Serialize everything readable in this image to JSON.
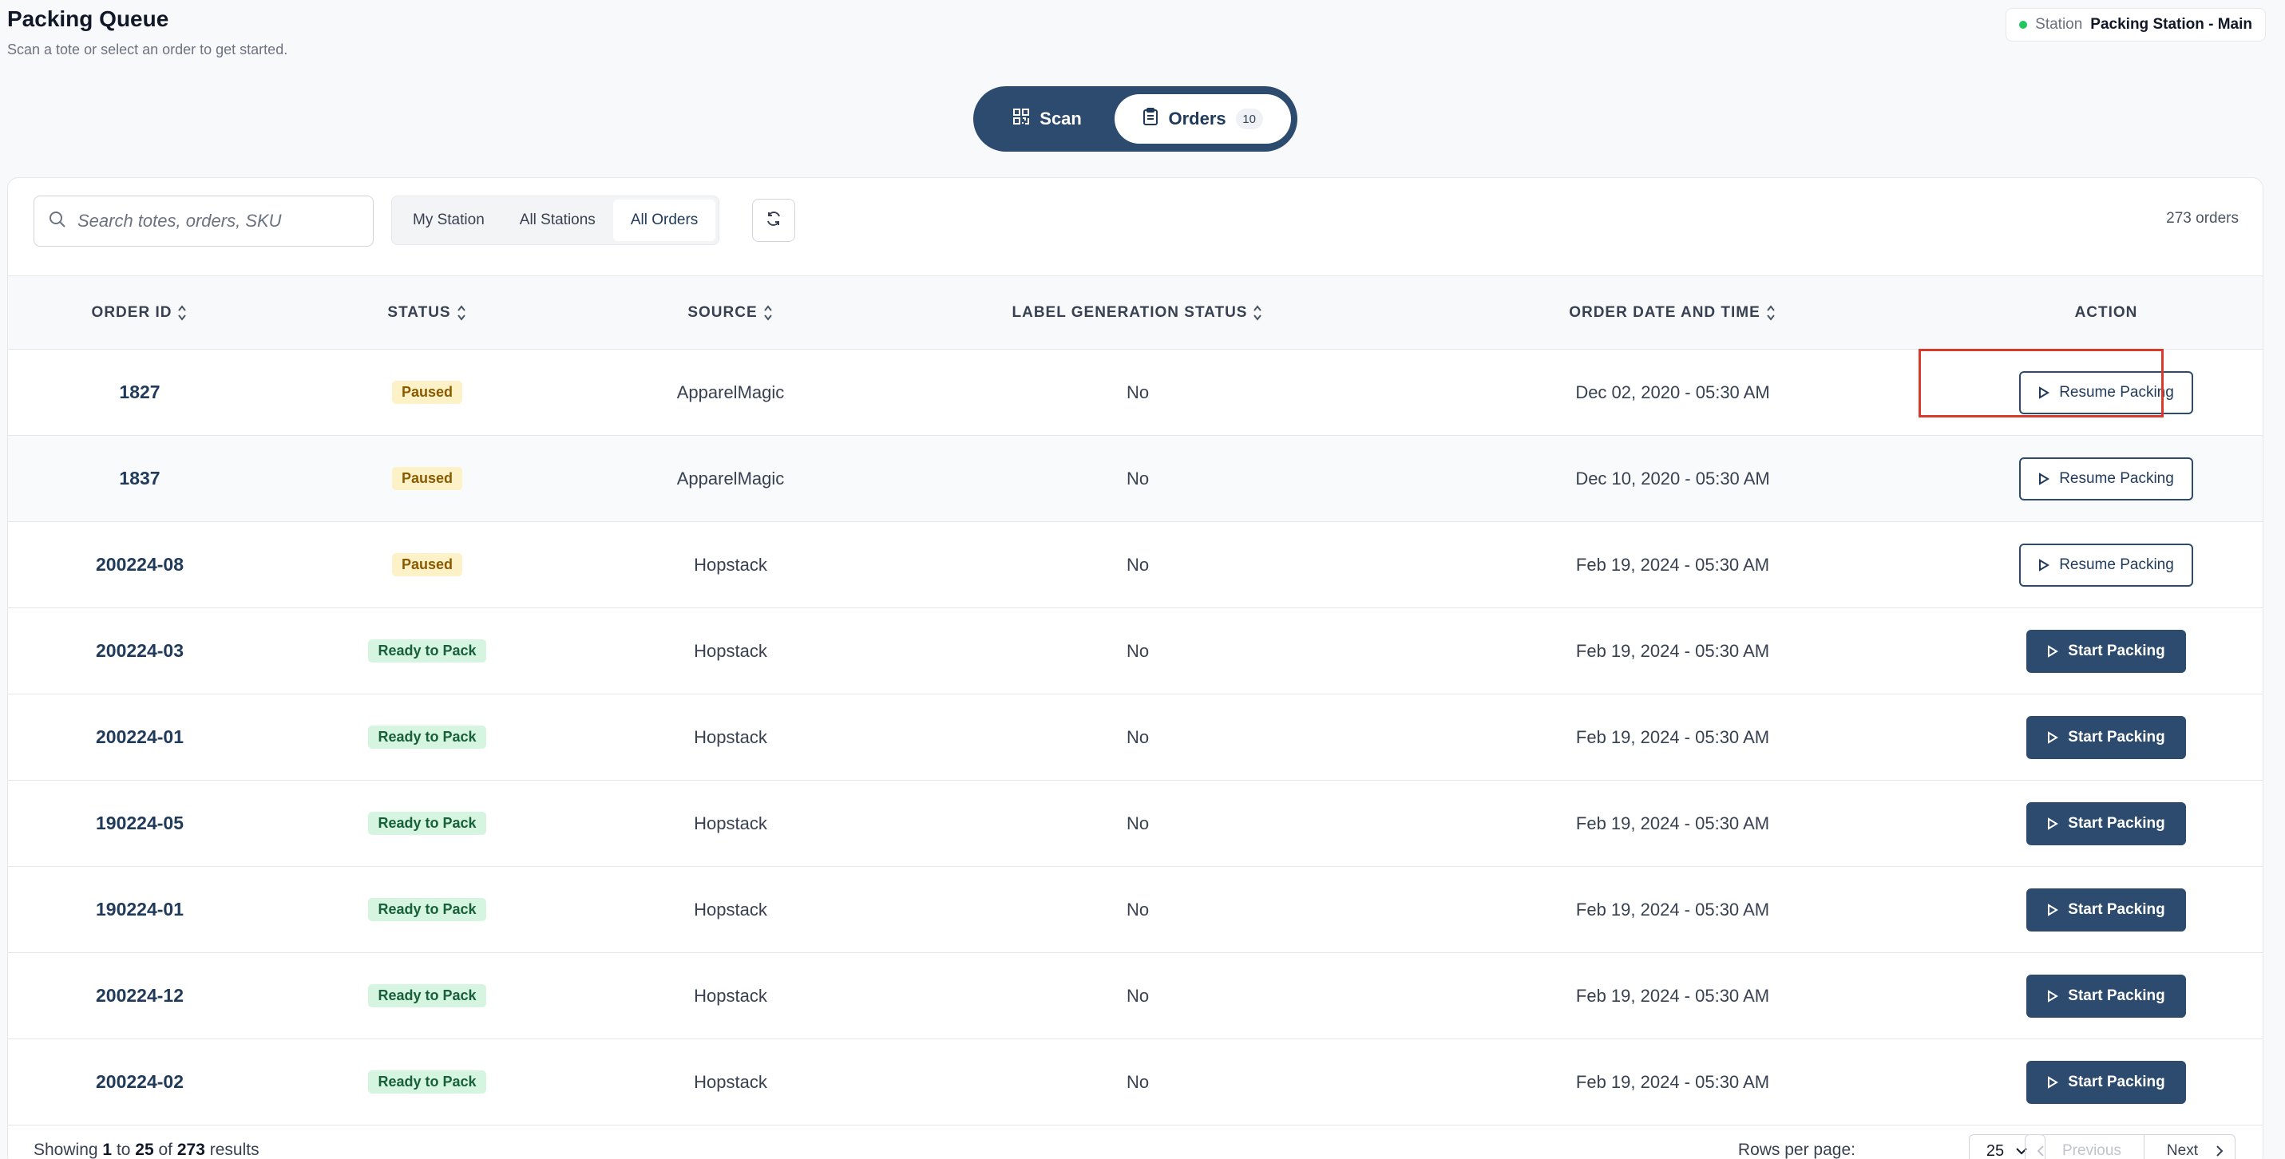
{
  "header": {
    "title": "Packing Queue",
    "subtitle": "Scan a tote or select an order to get started.",
    "station_label": "Station",
    "station_name": "Packing Station - Main"
  },
  "toggle": {
    "scan_label": "Scan",
    "orders_label": "Orders",
    "orders_count": "10"
  },
  "toolbar": {
    "search_placeholder": "Search totes, orders, SKU",
    "filters": [
      "My Station",
      "All Stations",
      "All Orders"
    ],
    "active_filter": "All Orders",
    "order_count": "273 orders"
  },
  "table": {
    "columns": [
      "ORDER ID",
      "STATUS",
      "SOURCE",
      "LABEL GENERATION STATUS",
      "ORDER DATE AND TIME",
      "ACTION"
    ],
    "rows": [
      {
        "order_id": "1827",
        "status": "Paused",
        "source": "ApparelMagic",
        "label": "No",
        "date": "Dec 02, 2020 - 05:30 AM",
        "action": "Resume Packing"
      },
      {
        "order_id": "1837",
        "status": "Paused",
        "source": "ApparelMagic",
        "label": "No",
        "date": "Dec 10, 2020 - 05:30 AM",
        "action": "Resume Packing"
      },
      {
        "order_id": "200224-08",
        "status": "Paused",
        "source": "Hopstack",
        "label": "No",
        "date": "Feb 19, 2024 - 05:30 AM",
        "action": "Resume Packing"
      },
      {
        "order_id": "200224-03",
        "status": "Ready to Pack",
        "source": "Hopstack",
        "label": "No",
        "date": "Feb 19, 2024 - 05:30 AM",
        "action": "Start Packing"
      },
      {
        "order_id": "200224-01",
        "status": "Ready to Pack",
        "source": "Hopstack",
        "label": "No",
        "date": "Feb 19, 2024 - 05:30 AM",
        "action": "Start Packing"
      },
      {
        "order_id": "190224-05",
        "status": "Ready to Pack",
        "source": "Hopstack",
        "label": "No",
        "date": "Feb 19, 2024 - 05:30 AM",
        "action": "Start Packing"
      },
      {
        "order_id": "190224-01",
        "status": "Ready to Pack",
        "source": "Hopstack",
        "label": "No",
        "date": "Feb 19, 2024 - 05:30 AM",
        "action": "Start Packing"
      },
      {
        "order_id": "200224-12",
        "status": "Ready to Pack",
        "source": "Hopstack",
        "label": "No",
        "date": "Feb 19, 2024 - 05:30 AM",
        "action": "Start Packing"
      },
      {
        "order_id": "200224-02",
        "status": "Ready to Pack",
        "source": "Hopstack",
        "label": "No",
        "date": "Feb 19, 2024 - 05:30 AM",
        "action": "Start Packing"
      }
    ]
  },
  "footer": {
    "showing_prefix": "Showing",
    "from": "1",
    "to_word": "to",
    "to": "25",
    "of_word": "of",
    "total": "273",
    "results_word": "results",
    "rows_per_page_label": "Rows per page:",
    "rows_per_page": "25",
    "prev_label": "Previous",
    "next_label": "Next"
  },
  "colors": {
    "primary": "#2c4b6e",
    "paused_bg": "#fdf1c7",
    "ready_bg": "#d6f5e0",
    "highlight": "#d93a2b"
  }
}
